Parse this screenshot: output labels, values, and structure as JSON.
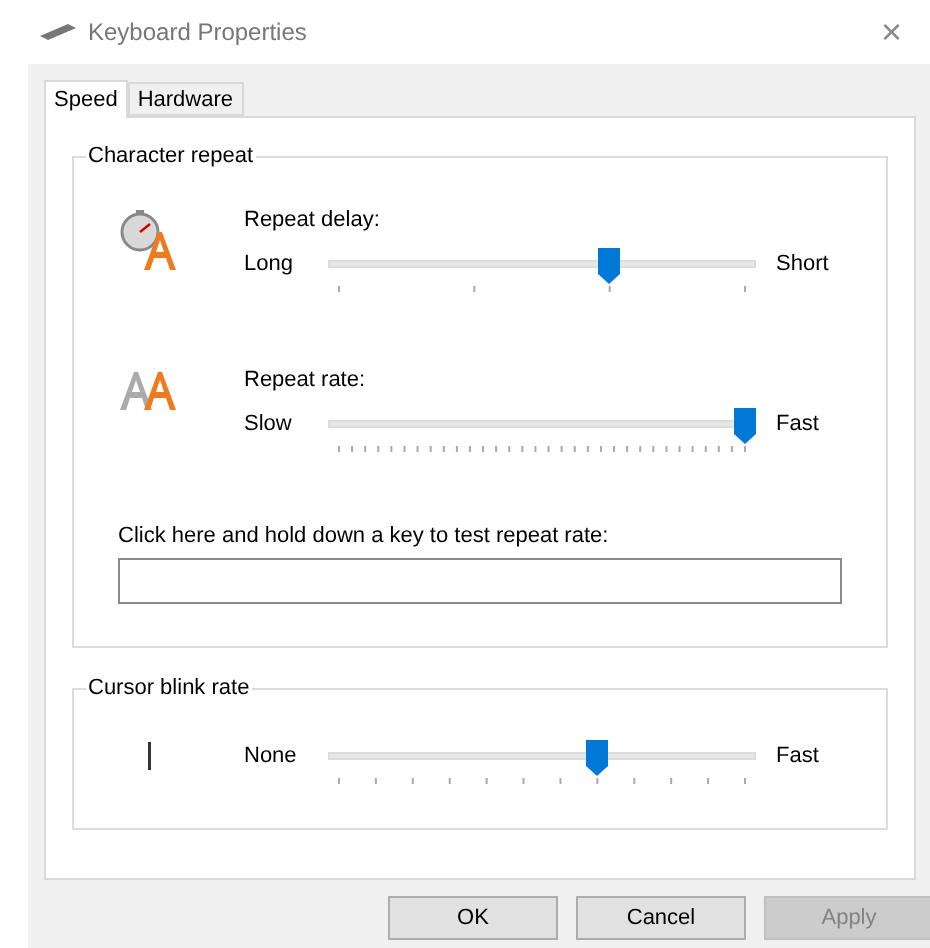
{
  "window": {
    "title": "Keyboard Properties",
    "close": "×"
  },
  "tabs": [
    {
      "label": "Speed",
      "selected": true
    },
    {
      "label": "Hardware",
      "selected": false
    }
  ],
  "character_repeat": {
    "title": "Character repeat",
    "sliders": [
      {
        "kind": "delay",
        "label": "Repeat delay:",
        "left": "Long",
        "right": "Short",
        "level": 0.667
      },
      {
        "kind": "rate",
        "label": "Repeat rate:",
        "left": "Slow",
        "right": "Fast",
        "level": 1
      }
    ],
    "test_field": {
      "label": "Click here and hold down a key to test repeat rate:"
    }
  },
  "cursor_blink": {
    "title": "Cursor blink rate",
    "left": "None",
    "right": "Fast",
    "level": 0.636
  },
  "buttons": [
    {
      "label": "OK",
      "disabled": false
    },
    {
      "label": "Cancel",
      "disabled": false
    },
    {
      "label": "Apply",
      "disabled": true
    }
  ]
}
